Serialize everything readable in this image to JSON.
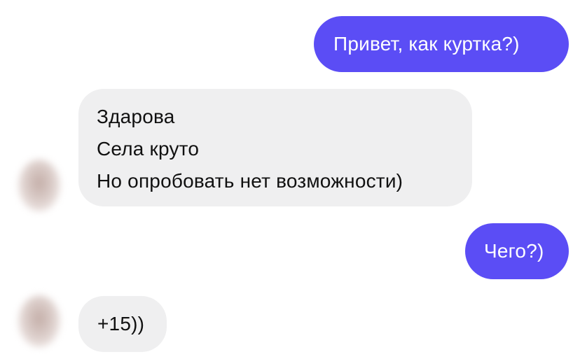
{
  "chat": {
    "messages": [
      {
        "direction": "outgoing",
        "lines": [
          "Привет, как куртка?)"
        ]
      },
      {
        "direction": "incoming",
        "lines": [
          "Здарова",
          "Села круто",
          "Но опробовать нет возможности)"
        ]
      },
      {
        "direction": "outgoing",
        "lines": [
          "Чего?)"
        ]
      },
      {
        "direction": "incoming",
        "lines": [
          "+15))"
        ]
      }
    ]
  },
  "colors": {
    "outgoing_bubble": "#5b4df5",
    "incoming_bubble": "#efeff0",
    "outgoing_text": "#ffffff",
    "incoming_text": "#111111"
  }
}
